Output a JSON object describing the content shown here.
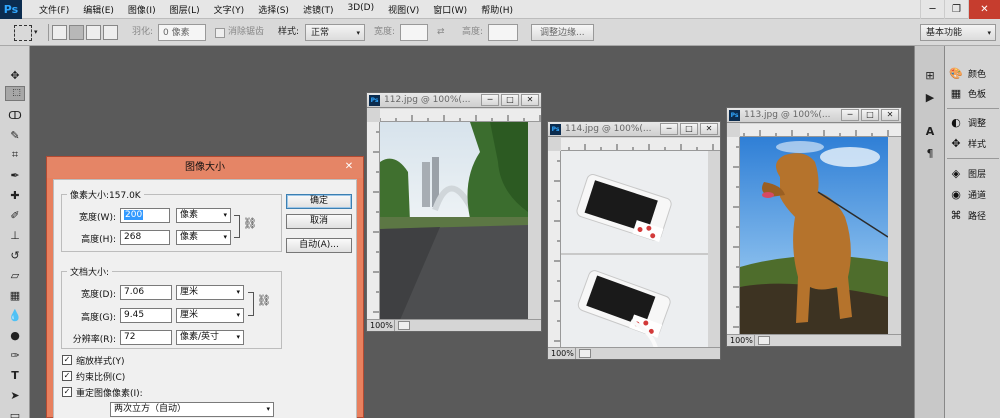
{
  "app": {
    "logo": "Ps"
  },
  "menu": [
    "文件(F)",
    "编辑(E)",
    "图像(I)",
    "图层(L)",
    "文字(Y)",
    "选择(S)",
    "滤镜(T)",
    "3D(D)",
    "视图(V)",
    "窗口(W)",
    "帮助(H)"
  ],
  "window_controls": {
    "minimize": "─",
    "restore": "❐",
    "close": "✕"
  },
  "options": {
    "feather_label": "羽化:",
    "feather_value": "0 像素",
    "antialias_label": "消除锯齿",
    "style_label": "样式:",
    "style_value": "正常",
    "width_label": "宽度:",
    "height_label": "高度:",
    "refine_edge": "调整边缘...",
    "workspace": "基本功能"
  },
  "right_panel": {
    "items": [
      {
        "label": "颜色",
        "icon": "palette-icon"
      },
      {
        "label": "色板",
        "icon": "grid-icon"
      },
      {
        "label": "调整",
        "icon": "adjust-icon"
      },
      {
        "label": "样式",
        "icon": "style-icon"
      },
      {
        "label": "图层",
        "icon": "layers-icon"
      },
      {
        "label": "通道",
        "icon": "channels-icon"
      },
      {
        "label": "路径",
        "icon": "paths-icon"
      }
    ]
  },
  "documents": [
    {
      "title": "112.jpg @ 100%(...",
      "zoom": "100%"
    },
    {
      "title": "114.jpg @ 100%(...",
      "zoom": "100%"
    },
    {
      "title": "113.jpg @ 100%(...",
      "zoom": "100%"
    }
  ],
  "dialog": {
    "title": "图像大小",
    "pixel_dims": {
      "label": "像素大小:157.0K",
      "width_label": "宽度(W):",
      "width_value": "200",
      "width_unit": "像素",
      "height_label": "高度(H):",
      "height_value": "268",
      "height_unit": "像素"
    },
    "doc_size": {
      "label": "文档大小:",
      "width_label": "宽度(D):",
      "width_value": "7.06",
      "width_unit": "厘米",
      "height_label": "高度(G):",
      "height_value": "9.45",
      "height_unit": "厘米",
      "res_label": "分辨率(R):",
      "res_value": "72",
      "res_unit": "像素/英寸"
    },
    "buttons": {
      "ok": "确定",
      "cancel": "取消",
      "auto": "自动(A)..."
    },
    "checks": {
      "scale_styles": "缩放样式(Y)",
      "constrain": "约束比例(C)",
      "resample": "重定图像像素(I):"
    },
    "resample_method": "两次立方（自动）"
  }
}
